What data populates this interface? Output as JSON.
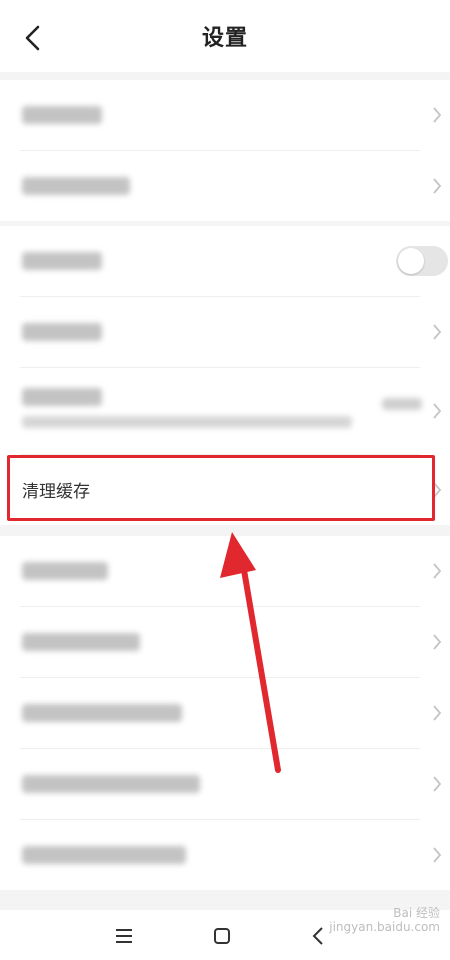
{
  "header": {
    "title": "设置"
  },
  "groups": [
    {
      "rows": [
        {
          "kind": "blurred-link"
        },
        {
          "kind": "blurred-link"
        }
      ]
    },
    {
      "rows": [
        {
          "kind": "blurred-toggle",
          "toggle_on": false
        },
        {
          "kind": "blurred-link"
        },
        {
          "kind": "blurred-link-with-subtitle"
        },
        {
          "kind": "link",
          "label": "清理缓存",
          "highlighted": true
        }
      ]
    },
    {
      "rows": [
        {
          "kind": "blurred-link"
        },
        {
          "kind": "blurred-link"
        },
        {
          "kind": "blurred-link"
        },
        {
          "kind": "blurred-link"
        },
        {
          "kind": "blurred-link"
        }
      ]
    }
  ],
  "annotation": {
    "highlight_color": "#e0282e",
    "arrow_color": "#e0282e"
  },
  "watermark": {
    "line1": "Bai 经验",
    "line2": "jingyan.baidu.com"
  },
  "icons": [
    "back-icon",
    "chevron-right-icon",
    "menu-icon",
    "home-icon",
    "back-nav-icon"
  ]
}
